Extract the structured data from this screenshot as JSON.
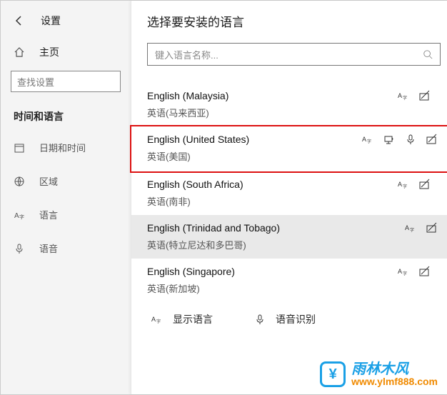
{
  "header": {
    "back_title": "设置"
  },
  "sidebar": {
    "home_label": "主页",
    "search_placeholder": "查找设置",
    "section_title": "时间和语言",
    "items": [
      {
        "label": "日期和时间"
      },
      {
        "label": "区域"
      },
      {
        "label": "语言"
      },
      {
        "label": "语音"
      }
    ]
  },
  "dialog": {
    "title": "选择要安装的语言",
    "search_placeholder": "键入语言名称...",
    "languages": [
      {
        "primary": "English (Malaysia)",
        "secondary": "英语(马来西亚)",
        "features": [
          "display",
          "handwriting"
        ],
        "selected": false,
        "highlighted": false
      },
      {
        "primary": "English (United States)",
        "secondary": "英语(美国)",
        "features": [
          "display",
          "tts",
          "voice",
          "handwriting"
        ],
        "selected": false,
        "highlighted": true
      },
      {
        "primary": "English (South Africa)",
        "secondary": "英语(南非)",
        "features": [
          "display",
          "handwriting"
        ],
        "selected": false,
        "highlighted": false
      },
      {
        "primary": "English (Trinidad and Tobago)",
        "secondary": "英语(特立尼达和多巴哥)",
        "features": [
          "display",
          "handwriting"
        ],
        "selected": true,
        "highlighted": false
      },
      {
        "primary": "English (Singapore)",
        "secondary": "英语(新加坡)",
        "features": [
          "display",
          "handwriting"
        ],
        "selected": false,
        "highlighted": false
      }
    ],
    "legend": [
      {
        "icon": "display",
        "label": "显示语言"
      },
      {
        "icon": "voice",
        "label": "语音识别"
      }
    ]
  },
  "watermark": {
    "brand": "雨林木风",
    "url": "www.ylmf888.com"
  }
}
